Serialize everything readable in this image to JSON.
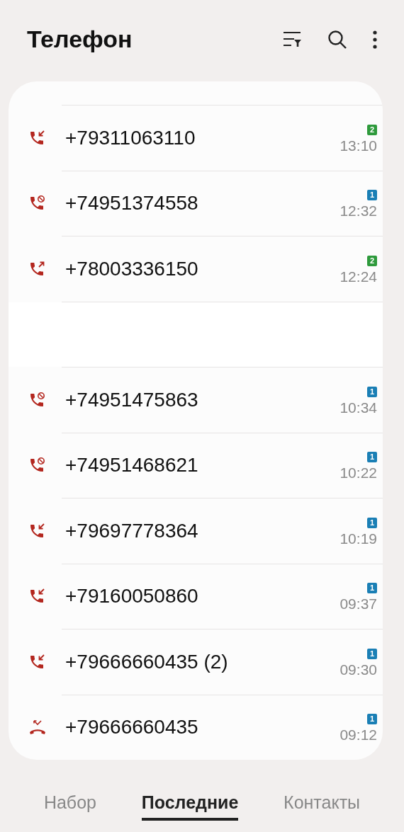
{
  "header": {
    "title": "Телефон"
  },
  "calls": [
    {
      "kind": "incoming",
      "number": "+79311063110",
      "sim": "2",
      "color": "#2e9a3c",
      "time": "13:10"
    },
    {
      "kind": "blocked",
      "number": "+74951374558",
      "sim": "1",
      "color": "#1a7fb5",
      "time": "12:32"
    },
    {
      "kind": "outgoing",
      "number": "+78003336150",
      "sim": "2",
      "color": "#2e9a3c",
      "time": "12:24"
    },
    {
      "kind": "blank"
    },
    {
      "kind": "blocked",
      "number": "+74951475863",
      "sim": "1",
      "color": "#1a7fb5",
      "time": "10:34"
    },
    {
      "kind": "blocked",
      "number": "+74951468621",
      "sim": "1",
      "color": "#1a7fb5",
      "time": "10:22"
    },
    {
      "kind": "incoming",
      "number": "+79697778364",
      "sim": "1",
      "color": "#1a7fb5",
      "time": "10:19"
    },
    {
      "kind": "incoming",
      "number": "+79160050860",
      "sim": "1",
      "color": "#1a7fb5",
      "time": "09:37"
    },
    {
      "kind": "incoming",
      "number": "+79666660435 (2)",
      "sim": "1",
      "color": "#1a7fb5",
      "time": "09:30"
    },
    {
      "kind": "rejected",
      "number": "+79666660435",
      "sim": "1",
      "color": "#1a7fb5",
      "time": "09:12"
    }
  ],
  "tabs": [
    {
      "label": "Набор",
      "selected": false
    },
    {
      "label": "Последние",
      "selected": true
    },
    {
      "label": "Контакты",
      "selected": false
    }
  ]
}
